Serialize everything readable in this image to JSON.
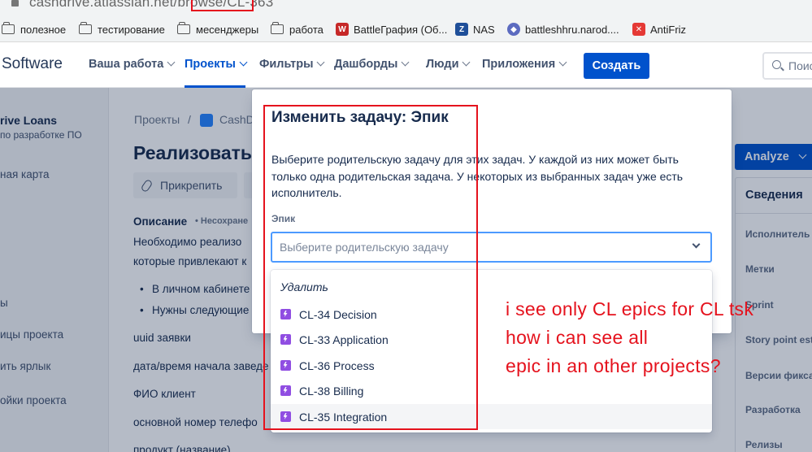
{
  "browser": {
    "url_host": "cashdrive.atlassian.net/browse/",
    "url_issue": "CL-363"
  },
  "bookmarks": [
    {
      "label": "полезное",
      "icon": "folder-icon"
    },
    {
      "label": "тестирование",
      "icon": "folder-icon"
    },
    {
      "label": "месенджеры",
      "icon": "folder-icon"
    },
    {
      "label": "работа",
      "icon": "folder-icon"
    },
    {
      "label": "BattleГрафия (Об...",
      "icon": "battlegrafia-icon",
      "color": "#c62828"
    },
    {
      "label": "NAS",
      "icon": "nas-icon",
      "color": "#1f4f99"
    },
    {
      "label": "battleshhru.narod....",
      "icon": "shield-icon",
      "color": "#5c6bc0"
    },
    {
      "label": "AntiFriz",
      "icon": "antifriz-icon",
      "color": "#e53935"
    }
  ],
  "nav": {
    "logo": "Software",
    "items": [
      "Ваша работа",
      "Проекты",
      "Фильтры",
      "Дашборды",
      "Люди",
      "Приложения"
    ],
    "active_index": 1,
    "create": "Создать",
    "search_placeholder": "Поис"
  },
  "sidebar": {
    "project_name": "rive Loans",
    "project_type": "по разработке ПО",
    "items": [
      "ная карта",
      "ы",
      "ицы проекта",
      "ить ярлык",
      "ойки проекта"
    ]
  },
  "issue": {
    "breadcrumb_root": "Проекты",
    "breadcrumb_sep": "/",
    "breadcrumb_project": "CashD",
    "title": "Реализовать ,",
    "attach": "Прикрепить",
    "description_label": "Описание",
    "unsaved": "• Несохране",
    "desc_line1": "Необходимо реализо",
    "desc_line2": "которые привлекают к",
    "bullet1": "В личном кабинете",
    "bullet2": "Нужны следующие",
    "fields": [
      "uuid заявки",
      "дата/время начала заведе",
      "ФИО клиент",
      "основной номер телефо",
      "продукт (название)"
    ]
  },
  "right_panel": {
    "analyze": "Analyze",
    "details": "Сведения",
    "labels": [
      "Исполнитель",
      "Метки",
      "Sprint",
      "Story point est",
      "Версии фикса",
      "Разработка",
      "Релизы"
    ]
  },
  "modal": {
    "title": "Изменить задачу: Эпик",
    "description": "Выберите родительскую задачу для этих задач. У каждой из них может быть только одна родительская задача. У некоторых из выбранных задач уже есть исполнитель.",
    "field_label": "Эпик",
    "placeholder": "Выберите родительскую задачу",
    "remove_option": "Удалить",
    "options": [
      "CL-34 Decision",
      "CL-33 Application",
      "CL-36 Process",
      "CL-38 Billing",
      "CL-35 Integration"
    ],
    "hovered_option_index": 4
  },
  "annotation": {
    "lines": [
      "i see only CL epics for CL tsk",
      "how i can see all",
      "epic in an other projects?"
    ],
    "color": "#e5121d"
  },
  "colors": {
    "primary": "#0052cc",
    "epic": "#904ee2",
    "focus": "#4c9aff"
  }
}
